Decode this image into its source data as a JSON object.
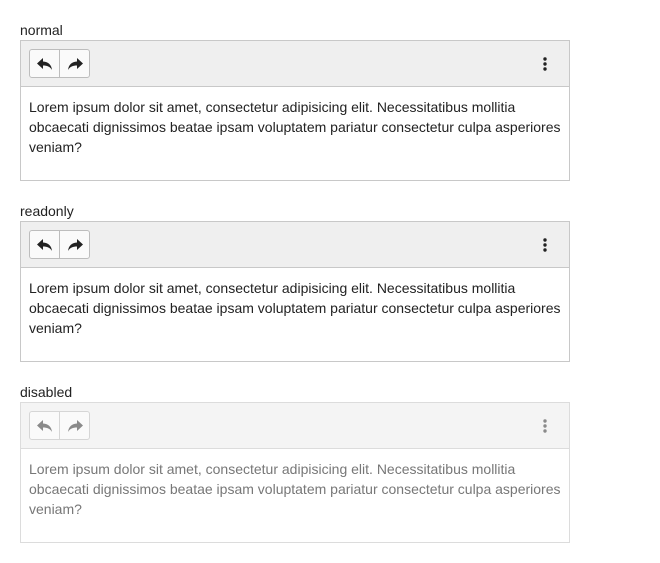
{
  "editors": [
    {
      "label": "normal",
      "content": "Lorem ipsum dolor sit amet, consectetur adipisicing elit. Necessitatibus mollitia obcaecati dignissimos beatae ipsam voluptatem pariatur consectetur culpa asperiores veniam?",
      "state": "normal",
      "toolbar": {
        "undo_icon": "undo-icon",
        "redo_icon": "redo-icon",
        "more_icon": "more-vertical-icon"
      }
    },
    {
      "label": "readonly",
      "content": "Lorem ipsum dolor sit amet, consectetur adipisicing elit. Necessitatibus mollitia obcaecati dignissimos beatae ipsam voluptatem pariatur consectetur culpa asperiores veniam?",
      "state": "readonly",
      "toolbar": {
        "undo_icon": "undo-icon",
        "redo_icon": "redo-icon",
        "more_icon": "more-vertical-icon"
      }
    },
    {
      "label": "disabled",
      "content": "Lorem ipsum dolor sit amet, consectetur adipisicing elit. Necessitatibus mollitia obcaecati dignissimos beatae ipsam voluptatem pariatur consectetur culpa asperiores veniam?",
      "state": "disabled",
      "toolbar": {
        "undo_icon": "undo-icon",
        "redo_icon": "redo-icon",
        "more_icon": "more-vertical-icon"
      }
    }
  ],
  "colors": {
    "toolbar_bg": "#efefef",
    "border": "#c8c8c8",
    "text": "#222222",
    "disabled_text": "#777777"
  }
}
